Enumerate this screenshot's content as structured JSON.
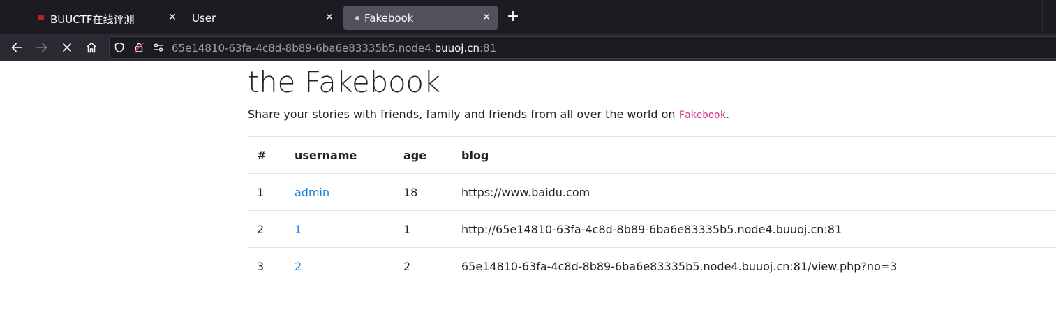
{
  "browser": {
    "tabs": [
      {
        "title": "BUUCTF在线评测",
        "favicon": "buuctf-icon",
        "active": false
      },
      {
        "title": "User",
        "favicon": "",
        "active": false
      },
      {
        "title": "Fakebook",
        "favicon": "page-icon",
        "active": true
      }
    ],
    "url": {
      "prefix": "65e14810-63fa-4c8d-8b89-6ba6e83335b5.node4.",
      "domain": "buuoj.cn",
      "suffix": ":81"
    },
    "colors": {
      "tabbar": "#1c1b22",
      "navbar": "#2b2a33",
      "active_tab": "#52525e"
    }
  },
  "page": {
    "title": "the Fakebook",
    "lead_text": "Share your stories with friends, family and friends from all over the world on ",
    "lead_brand": "Fakebook",
    "lead_end": ".",
    "table": {
      "headers": [
        "#",
        "username",
        "age",
        "blog"
      ],
      "rows": [
        {
          "no": "1",
          "username": "admin",
          "age": "18",
          "blog": "https://www.baidu.com"
        },
        {
          "no": "2",
          "username": "1",
          "age": "1",
          "blog": "http://65e14810-63fa-4c8d-8b89-6ba6e83335b5.node4.buuoj.cn:81"
        },
        {
          "no": "3",
          "username": "2",
          "age": "2",
          "blog": "65e14810-63fa-4c8d-8b89-6ba6e83335b5.node4.buuoj.cn:81/view.php?no=3"
        }
      ]
    },
    "colors": {
      "text": "#212529",
      "link": "#1a7fd8",
      "brand": "#d63384",
      "divider": "#dee2e6"
    }
  }
}
